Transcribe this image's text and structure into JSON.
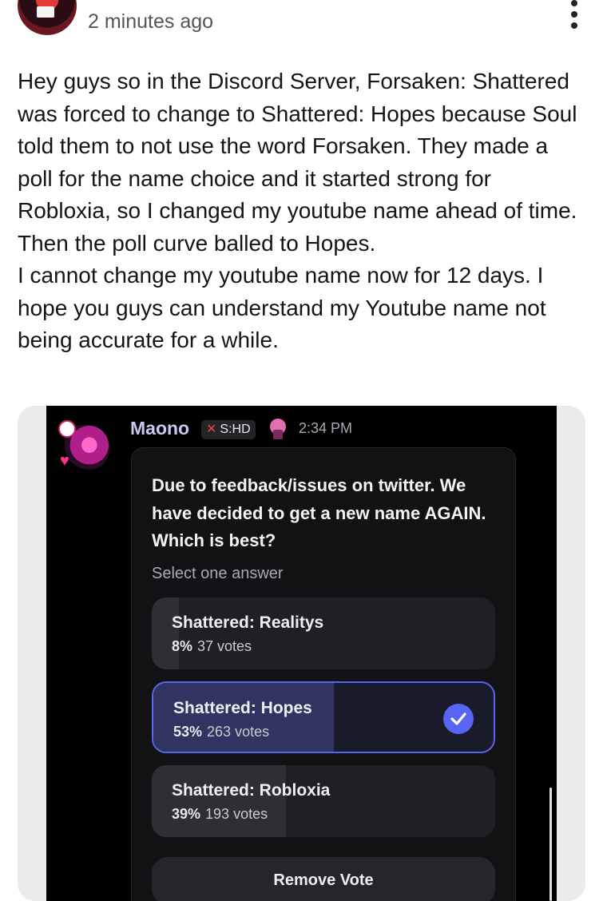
{
  "post": {
    "timestamp": "2 minutes ago",
    "body": "Hey guys so in the Discord Server, Forsaken: Shattered was forced to change to Shattered: Hopes because Soul told them to not use the word Forsaken. They made a poll for the name choice and it started strong for Robloxia, so I changed my youtube name ahead of time.\nThen the poll curve balled to Hopes.\nI cannot change my youtube name now for 12 days. I hope you guys can understand my Youtube name not being accurate for a while."
  },
  "discord": {
    "username": "Maono",
    "tag": "S:HD",
    "time": "2:34 PM",
    "poll": {
      "question": "Due to feedback/issues on twitter. We have decided to get a new name AGAIN. Which is best?",
      "instruction": "Select one answer",
      "options": [
        {
          "label": "Shattered: Realitys",
          "percent": "8%",
          "votes": "37 votes",
          "fraction": 0.08,
          "selected": false
        },
        {
          "label": "Shattered: Hopes",
          "percent": "53%",
          "votes": "263 votes",
          "fraction": 0.53,
          "selected": true
        },
        {
          "label": "Shattered: Robloxia",
          "percent": "39%",
          "votes": "193 votes",
          "fraction": 0.39,
          "selected": false
        }
      ],
      "remove_vote": "Remove Vote"
    }
  },
  "colors": {
    "accent": "#5865f2",
    "name": "#c6c8f0"
  },
  "icons": {
    "menu": "more-vert-icon",
    "check": "check-circle-icon",
    "tag_icon": "sword-icon"
  }
}
